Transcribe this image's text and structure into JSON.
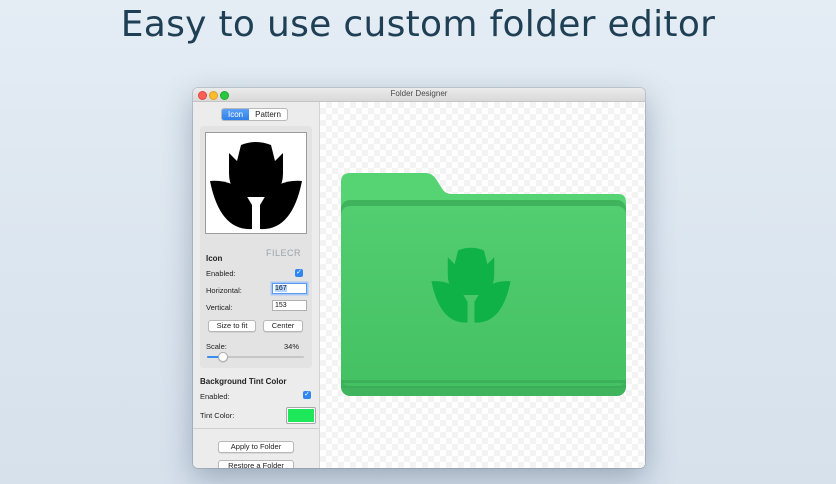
{
  "headline": "Easy to use custom folder editor",
  "window": {
    "title": "Folder Designer"
  },
  "tabs": [
    {
      "label": "Icon",
      "active": true
    },
    {
      "label": "Pattern",
      "active": false
    }
  ],
  "icon_section": {
    "heading": "Icon",
    "enabled_label": "Enabled:",
    "enabled": true,
    "horizontal_label": "Horizontal:",
    "horizontal_value": "167",
    "vertical_label": "Vertical:",
    "vertical_value": "153",
    "size_to_fit_label": "Size to fit",
    "center_label": "Center",
    "scale_label": "Scale:",
    "scale_value": "34%",
    "scale_fraction": 0.15
  },
  "background_section": {
    "heading": "Background Tint Color",
    "enabled_label": "Enabled:",
    "enabled": true,
    "tint_label": "Tint Color:",
    "tint_color": "#1ee85a"
  },
  "actions": {
    "apply_label": "Apply to Folder",
    "restore_label": "Restore a Folder"
  },
  "watermark": "FILECR",
  "colors": {
    "folder_green": "#4dcb6c",
    "folder_tab": "#56d474",
    "emblem_green": "#0fb246",
    "accent_blue": "#2f86ee"
  },
  "icons": {
    "preview": "tulip-icon",
    "emblem": "tulip-icon",
    "checkbox": "checkmark-icon"
  }
}
